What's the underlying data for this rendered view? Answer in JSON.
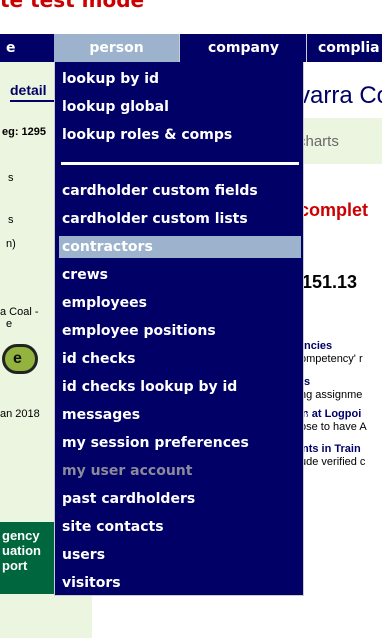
{
  "banner": {
    "text": "te test mode"
  },
  "nav": {
    "partial_left": "e",
    "person": "person",
    "company": "company",
    "compli": "complia"
  },
  "left": {
    "detail": "detail",
    "reg": "eg: 1295",
    "s1": "s",
    "s2": "s",
    "n": "n)",
    "coal": "a Coal -",
    "e2": "e",
    "oval_text": "e",
    "date": "an 2018",
    "green_lines": [
      "gency",
      "uation",
      "port"
    ]
  },
  "right": {
    "title": "varra Co",
    "charts": "charts",
    "complete": "complet",
    "ip": ".151.13",
    "line1": "ncies",
    "line2": "ompetency' r",
    "line3": "s",
    "line4": "ng assignme",
    "line5": "n at Logpoi",
    "line6": "ose to have A",
    "line7": "nts in Train",
    "line8": "ude verified c"
  },
  "menu": {
    "submenu_arrow": "»",
    "items": [
      "lookup by id",
      "lookup global",
      "lookup roles & comps",
      "cardholder custom fields",
      "cardholder custom lists",
      "contractors",
      "crews",
      "employees",
      "employee positions",
      "id checks",
      "id checks lookup by id",
      "messages",
      "my session preferences",
      "my user account",
      "past cardholders",
      "site contacts",
      "users",
      "visitors"
    ]
  },
  "colors": {
    "nav_bg": "#000066",
    "highlight": "#9db2cc",
    "panel_bg": "#ecf5df",
    "alert_red": "#cc0000",
    "green_block": "#00663e"
  }
}
